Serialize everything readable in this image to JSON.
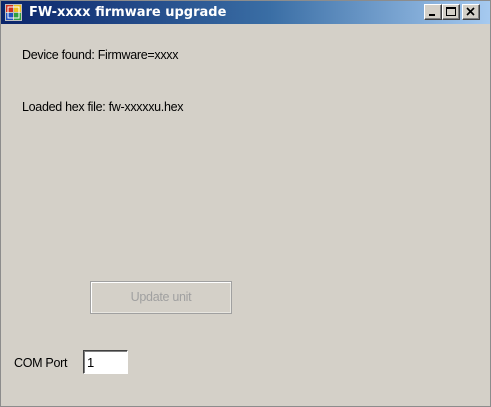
{
  "window": {
    "title": "FW-xxxx firmware upgrade",
    "title_bar_colors": [
      "#0a246a",
      "#a6caf0"
    ],
    "face_color": "#d4d0c8",
    "controls": {
      "minimize_icon": "minimize-icon",
      "maximize_icon": "maximize-icon",
      "close_icon": "close-icon"
    }
  },
  "main": {
    "device_status": "Device found: Firmware=xxxx",
    "hex_file_status": "Loaded hex file: fw-xxxxxu.hex",
    "update_button_label": "Update unit",
    "update_button_enabled": false,
    "com_port": {
      "label": "COM Port",
      "value": "1"
    }
  }
}
